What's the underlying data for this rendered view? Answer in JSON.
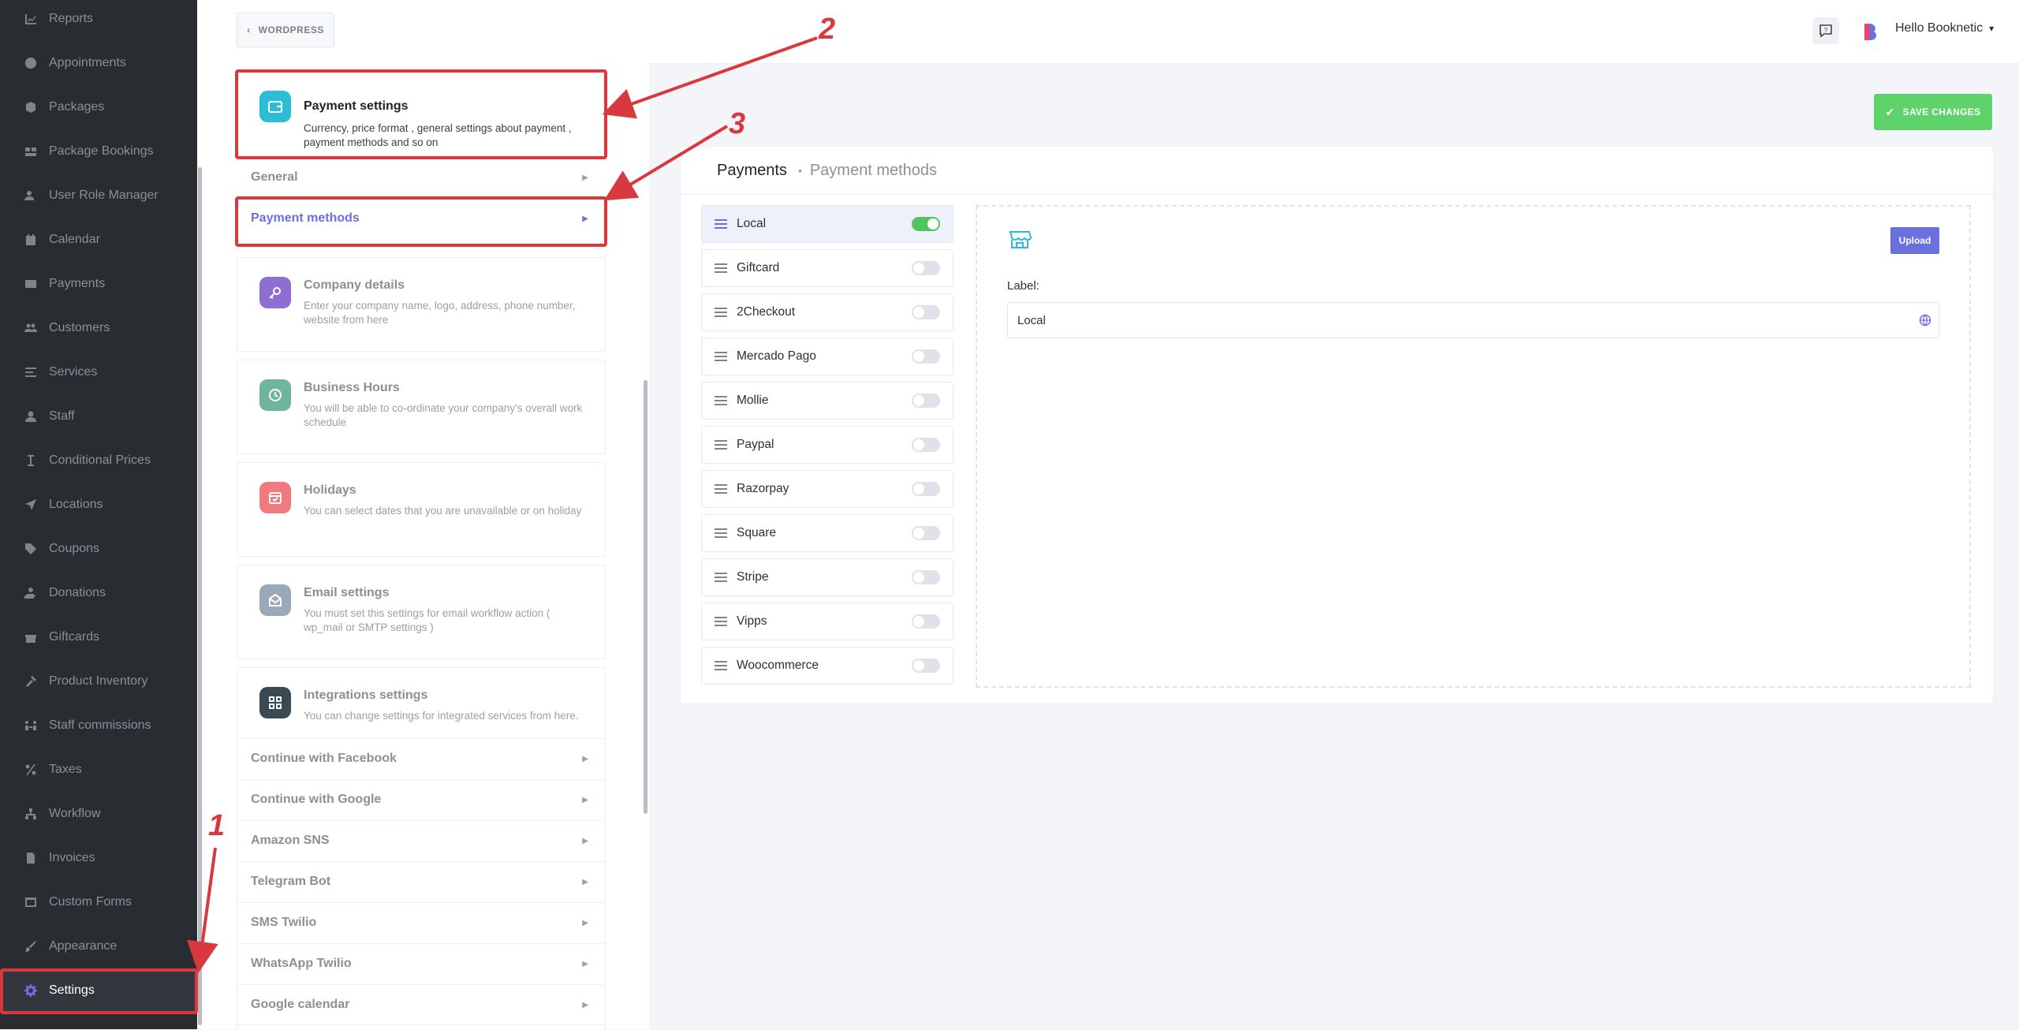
{
  "sidebar": {
    "items": [
      {
        "label": "Reports",
        "icon": "chart-line-icon"
      },
      {
        "label": "Appointments",
        "icon": "clock-icon"
      },
      {
        "label": "Packages",
        "icon": "box-icon"
      },
      {
        "label": "Package Bookings",
        "icon": "boxes-icon"
      },
      {
        "label": "User Role Manager",
        "icon": "user-gear-icon"
      },
      {
        "label": "Calendar",
        "icon": "calendar-icon"
      },
      {
        "label": "Payments",
        "icon": "credit-card-icon"
      },
      {
        "label": "Customers",
        "icon": "users-icon"
      },
      {
        "label": "Services",
        "icon": "list-icon"
      },
      {
        "label": "Staff",
        "icon": "user-icon"
      },
      {
        "label": "Conditional Prices",
        "icon": "text-cursor-icon"
      },
      {
        "label": "Locations",
        "icon": "location-arrow-icon"
      },
      {
        "label": "Coupons",
        "icon": "tags-icon"
      },
      {
        "label": "Donations",
        "icon": "hand-holding-icon"
      },
      {
        "label": "Giftcards",
        "icon": "gift-icon"
      },
      {
        "label": "Product Inventory",
        "icon": "tools-icon"
      },
      {
        "label": "Staff commissions",
        "icon": "people-arrows-icon"
      },
      {
        "label": "Taxes",
        "icon": "percent-icon"
      },
      {
        "label": "Workflow",
        "icon": "sitemap-icon"
      },
      {
        "label": "Invoices",
        "icon": "file-icon"
      },
      {
        "label": "Custom Forms",
        "icon": "window-icon"
      },
      {
        "label": "Appearance",
        "icon": "brush-icon"
      },
      {
        "label": "Settings",
        "icon": "gear-icon",
        "active": true
      }
    ]
  },
  "topbar": {
    "back_label": "WORDPRESS",
    "user_greeting": "Hello Booknetic"
  },
  "settings_list": {
    "payment": {
      "title": "Payment settings",
      "desc": "Currency, price format , general settings about payment , payment methods and so on",
      "color": "#2bbdd6"
    },
    "payment_sub": {
      "general": "General",
      "methods": "Payment methods"
    },
    "company": {
      "title": "Company details",
      "desc": "Enter your company name, logo, address, phone number, website from here",
      "color": "#8e6ed1"
    },
    "hours": {
      "title": "Business Hours",
      "desc": "You will be able to co-ordinate your company's overall work schedule",
      "color": "#6fb59b"
    },
    "holidays": {
      "title": "Holidays",
      "desc": "You can select dates that you are unavailable or on holiday",
      "color": "#f07a7e"
    },
    "email": {
      "title": "Email settings",
      "desc": "You must set this settings for email workflow action ( wp_mail or SMTP settings )",
      "color": "#9aa9b8"
    },
    "integrations": {
      "title": "Integrations settings",
      "desc": "You can change settings for integrated services from here.",
      "color": "#3a4a52"
    },
    "integration_items": [
      "Continue with Facebook",
      "Continue with Google",
      "Amazon SNS",
      "Telegram Bot",
      "SMS Twilio",
      "WhatsApp Twilio",
      "Google calendar"
    ]
  },
  "main": {
    "save_label": "SAVE CHANGES",
    "title": "Payments",
    "subtitle": "Payment methods",
    "methods": [
      {
        "name": "Local",
        "enabled": true
      },
      {
        "name": "Giftcard",
        "enabled": false
      },
      {
        "name": "2Checkout",
        "enabled": false
      },
      {
        "name": "Mercado Pago",
        "enabled": false
      },
      {
        "name": "Mollie",
        "enabled": false
      },
      {
        "name": "Paypal",
        "enabled": false
      },
      {
        "name": "Razorpay",
        "enabled": false
      },
      {
        "name": "Square",
        "enabled": false
      },
      {
        "name": "Stripe",
        "enabled": false
      },
      {
        "name": "Vipps",
        "enabled": false
      },
      {
        "name": "Woocommerce",
        "enabled": false
      }
    ],
    "detail": {
      "upload_label": "Upload",
      "label_caption": "Label:",
      "label_value": "Local"
    }
  },
  "annotations": {
    "step1": "1",
    "step2": "2",
    "step3": "3",
    "color": "#d9383e"
  }
}
